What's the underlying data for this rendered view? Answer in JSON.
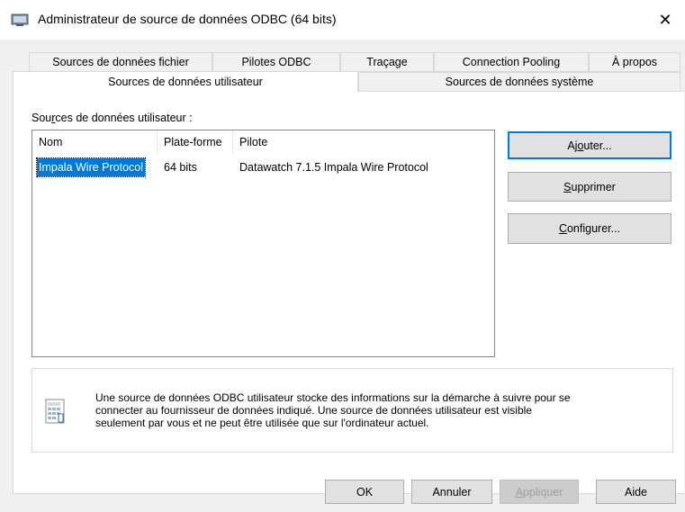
{
  "window": {
    "title": "Administrateur de source de données ODBC (64 bits)",
    "close_glyph": "✕"
  },
  "tabs_row1": [
    {
      "label": "Sources de données fichier"
    },
    {
      "label": "Pilotes ODBC"
    },
    {
      "label": "Traçage"
    },
    {
      "label": "Connection Pooling"
    },
    {
      "label": "À propos"
    }
  ],
  "tabs_row2": [
    {
      "label": "Sources de données utilisateur",
      "selected": true
    },
    {
      "label": "Sources de données système",
      "selected": false
    }
  ],
  "user_dsn": {
    "list_label_pre": "Sou",
    "list_label_ul": "r",
    "list_label_post": "ces de données utilisateur :",
    "columns": [
      "Nom",
      "Plate-forme",
      "Pilote"
    ],
    "rows": [
      {
        "name": "Impala Wire Protocol",
        "platform": "64 bits",
        "driver": "Datawatch 7.1.5 Impala Wire Protocol",
        "selected": true
      }
    ]
  },
  "side_buttons": {
    "add": {
      "pre": "Aj",
      "ul": "o",
      "post": "uter..."
    },
    "remove": {
      "pre": "",
      "ul": "S",
      "post": "upprimer"
    },
    "configure": {
      "pre": "",
      "ul": "C",
      "post": "onfigurer..."
    }
  },
  "info": {
    "icon": "odbc-datasource-icon",
    "text_line1": "Une source de données ODBC utilisateur stocke des informations sur la démarche à suivre pour se",
    "text_line2": "connecter au fournisseur de données indiqué.   Une source de données utilisateur est visible",
    "text_line3": "seulement par vous et ne peut être utilisée que sur l'ordinateur actuel."
  },
  "footer_buttons": {
    "ok": "OK",
    "cancel": "Annuler",
    "apply_ul": "A",
    "apply_post": "ppliquer",
    "help": "Aide"
  },
  "colors": {
    "selection": "#0078d7",
    "dialog_bg": "#f0f0f0",
    "button_bg": "#e1e1e1"
  }
}
